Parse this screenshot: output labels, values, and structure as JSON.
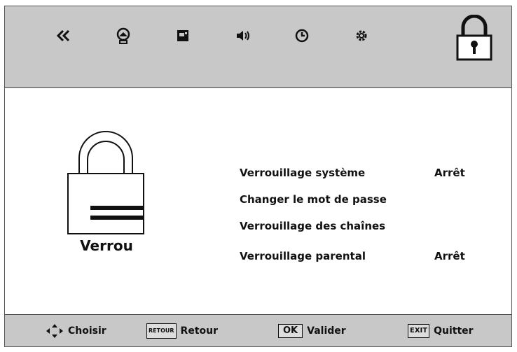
{
  "top_nav": {
    "icons": [
      "back-double-chevron-icon",
      "picture-icon",
      "input-source-icon",
      "sound-icon",
      "time-icon",
      "settings-gear-icon"
    ],
    "selected": "lock-icon"
  },
  "lock_panel": {
    "title": "Verrou",
    "items": [
      {
        "label": "Verrouillage système",
        "value": "Arrêt"
      },
      {
        "label": "Changer le mot de passe",
        "value": ""
      },
      {
        "label": "Verrouillage des chaînes",
        "value": ""
      },
      {
        "label": "Verrouillage parental",
        "value": "Arrêt"
      }
    ]
  },
  "footer": {
    "choose": "Choisir",
    "back_key": "RETOUR",
    "back": "Retour",
    "ok_key": "OK",
    "ok": "Valider",
    "exit_key": "EXIT",
    "exit": "Quitter"
  }
}
